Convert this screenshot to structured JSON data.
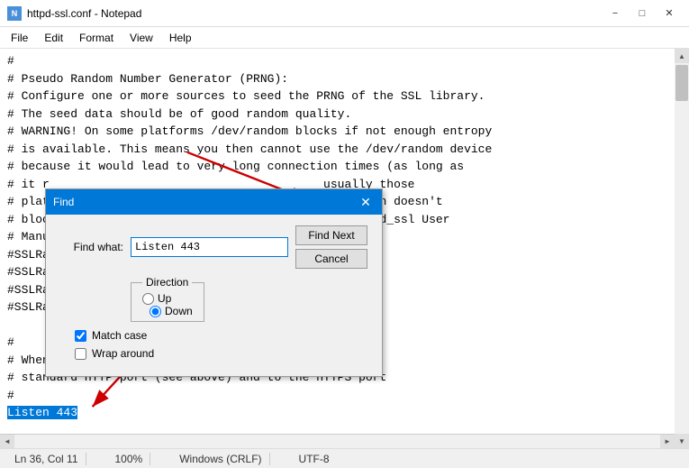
{
  "titleBar": {
    "title": "httpd-ssl.conf - Notepad",
    "icon": "N",
    "minimizeLabel": "−",
    "maximizeLabel": "□",
    "closeLabel": "✕"
  },
  "menuBar": {
    "items": [
      "File",
      "Edit",
      "Format",
      "View",
      "Help"
    ]
  },
  "editor": {
    "lines": [
      "#",
      "# Pseudo Random Number Generator (PRNG):",
      "# Configure one or more sources to seed the PRNG of the SSL library.",
      "# The seed data should be of good random quality.",
      "# WARNING! On some platforms /dev/random blocks if not enough entropy",
      "# is available. This means you then cannot use the /dev/random device",
      "# because it would lead to very long connection times (as long as",
      "# it r                                       usually those",
      "# plat                                      vice which doesn't",
      "# bloc                                     ead the mod_ssl User",
      "# Manu",
      "#SSLRa",
      "#SSLRa",
      "#SSLRa",
      "#SSLRandomSeed connect file:/dev/urandom 512",
      "",
      "#",
      "# When we also provide SSL we have to listen to the",
      "# standard HTTP port (see above) and to the HTTPS port",
      "#"
    ],
    "highlightedText": "Listen 443",
    "highlightLine": "Listen 443"
  },
  "findDialog": {
    "title": "Find",
    "findWhatLabel": "Find what:",
    "findWhatValue": "Listen 443",
    "findNextLabel": "Find Next",
    "cancelLabel": "Cancel",
    "directionLabel": "Direction",
    "upLabel": "Up",
    "downLabel": "Down",
    "matchCaseLabel": "Match case",
    "wrapAroundLabel": "Wrap around",
    "matchCaseChecked": true,
    "wrapAroundChecked": false,
    "directionDown": true
  },
  "statusBar": {
    "lineCol": "Ln 36, Col 11",
    "zoom": "100%",
    "lineEnding": "Windows (CRLF)",
    "encoding": "UTF-8"
  }
}
